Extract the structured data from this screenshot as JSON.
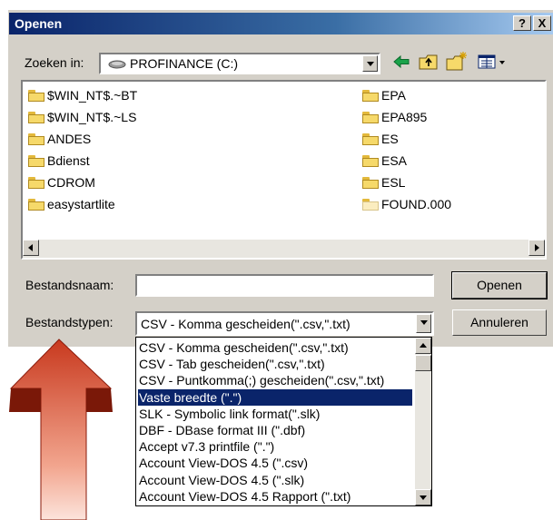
{
  "window": {
    "title": "Openen",
    "help_glyph": "?",
    "close_glyph": "X"
  },
  "toolbar": {
    "lookin_label": "Zoeken in:",
    "location": "PROFINANCE (C:)"
  },
  "files": {
    "left": [
      "$WIN_NT$.~BT",
      "$WIN_NT$.~LS",
      "ANDES",
      "Bdienst",
      "CDROM",
      "easystartlite"
    ],
    "right": [
      "EPA",
      "EPA895",
      "ES",
      "ESA",
      "ESL",
      "FOUND.000"
    ]
  },
  "form": {
    "filename_label": "Bestandsnaam:",
    "filename_value": "",
    "filetype_label": "Bestandstypen:",
    "filetype_value": "CSV - Komma gescheiden(\".csv,\".txt)",
    "open_button": "Openen",
    "cancel_button": "Annuleren"
  },
  "filetype_options": [
    "CSV - Komma gescheiden(\".csv,\".txt)",
    "CSV - Tab gescheiden(\".csv,\".txt)",
    "CSV - Puntkomma(;) gescheiden(\".csv,\".txt)",
    "Vaste breedte (\".\")",
    "SLK - Symbolic link format(\".slk)",
    "DBF - DBase format III (\".dbf)",
    "Accept v7.3 printfile (\".\")",
    "Account View-DOS 4.5 (\".csv)",
    "Account View-DOS 4.5 (\".slk)",
    "Account View-DOS 4.5 Rapport (\".txt)"
  ],
  "selected_option_index": 3,
  "colors": {
    "title_bar": "#0a246a",
    "selection": "#0a246a",
    "arrow": "#c8391e"
  },
  "icons": {
    "drive": "drive-icon",
    "back": "back-arrow-icon",
    "up": "up-folder-icon",
    "new_folder": "new-folder-icon",
    "view": "view-menu-icon"
  }
}
